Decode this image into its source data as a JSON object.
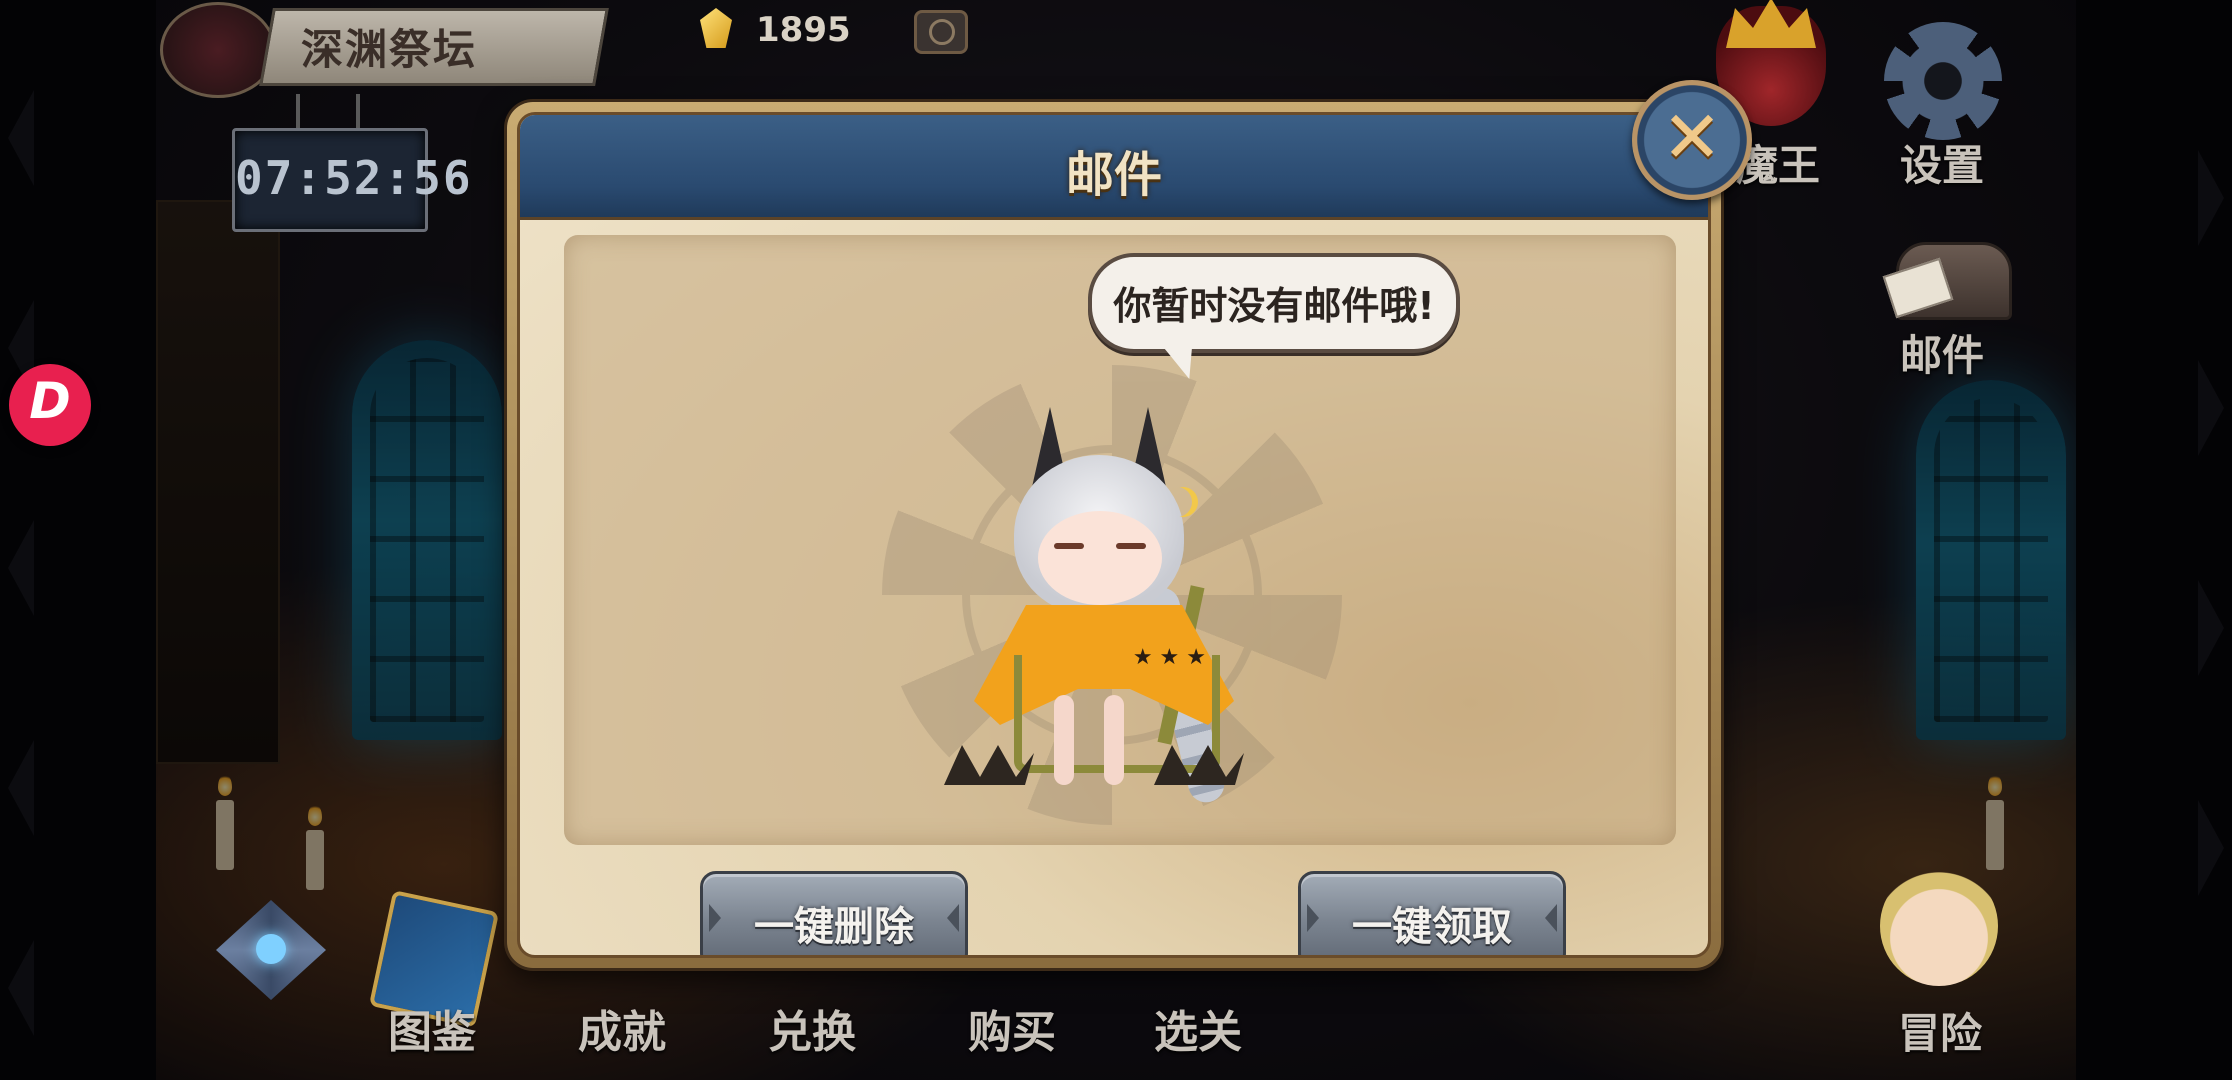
{
  "header": {
    "location_title": "深渊祭坛",
    "timer": "07:52:56",
    "gems": "1895"
  },
  "right_menu": {
    "boss_label": "魔王",
    "settings_label": "设置",
    "mail_label": "邮件",
    "adventure_label": "冒险"
  },
  "bottom_menu": {
    "items": [
      {
        "label": "图鉴"
      },
      {
        "label": "成就"
      },
      {
        "label": "兑换"
      },
      {
        "label": "购买"
      },
      {
        "label": "选关"
      }
    ]
  },
  "dialog": {
    "title": "邮件",
    "empty_message": "你暂时没有邮件哦!",
    "delete_all_label": "一键删除",
    "claim_all_label": "一键领取",
    "close_symbol": "✕"
  },
  "overlay": {
    "floating_logo_glyph": "D"
  },
  "colors": {
    "dialog_header": "#2a4a70",
    "parchment": "#efe3c9",
    "button_gray": "#7c8591",
    "close_ring": "#b99466",
    "logo_pink": "#e8204f",
    "window_glow": "#1a86a8"
  }
}
